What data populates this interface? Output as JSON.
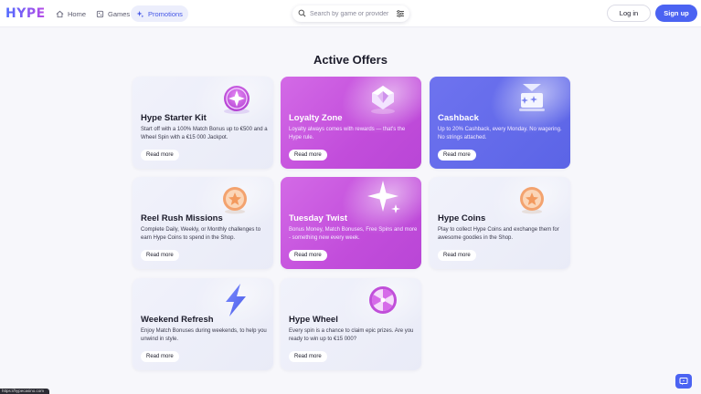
{
  "header": {
    "logo": "HYPE",
    "nav": [
      {
        "label": "Home",
        "icon": "home-icon"
      },
      {
        "label": "Games",
        "icon": "games-icon"
      },
      {
        "label": "Promotions",
        "icon": "sparkle-icon"
      }
    ],
    "search": {
      "placeholder": "Search by game or provider"
    },
    "login_label": "Log in",
    "signup_label": "Sign up"
  },
  "main": {
    "title": "Active Offers",
    "read_more_label": "Read more",
    "cards": [
      {
        "title": "Hype Starter Kit",
        "desc": "Start off with a 100% Match Bonus up to €500 and a Wheel Spin with a €15 000 Jackpot.",
        "style": "light",
        "emblem": "star-badge"
      },
      {
        "title": "Loyalty Zone",
        "desc": "Loyalty always comes with rewards — that's the Hype rule.",
        "style": "magenta",
        "emblem": "gem-badge"
      },
      {
        "title": "Cashback",
        "desc": "Up to 20% Cashback, every Monday. No wagering. No strings attached.",
        "style": "blue",
        "emblem": "gift-badge"
      },
      {
        "title": "Reel Rush Missions",
        "desc": "Complete Daily, Weekly, or Monthly challenges to earn Hype Coins to spend in the Shop.",
        "style": "light",
        "emblem": "coin-star"
      },
      {
        "title": "Tuesday Twist",
        "desc": "Bonus Money, Match Bonuses, Free Spins and more - something new every week.",
        "style": "magenta",
        "emblem": "sparkle"
      },
      {
        "title": "Hype Coins",
        "desc": "Play to collect Hype Coins and exchange them for awesome goodies in the Shop.",
        "style": "light",
        "emblem": "coin-star"
      },
      {
        "title": "Weekend Refresh",
        "desc": "Enjoy Match Bonuses during weekends, to help you unwind in style.",
        "style": "light",
        "emblem": "lightning"
      },
      {
        "title": "Hype Wheel",
        "desc": "Every spin is a chance to claim epic prizes. Are you ready to win up to €15 000?",
        "style": "light",
        "emblem": "wheel"
      }
    ]
  },
  "status_url": "https://hypecasino.com",
  "colors": {
    "accent": "#4b63f2",
    "magenta": "#c24ddb",
    "blue": "#5b64e6"
  }
}
